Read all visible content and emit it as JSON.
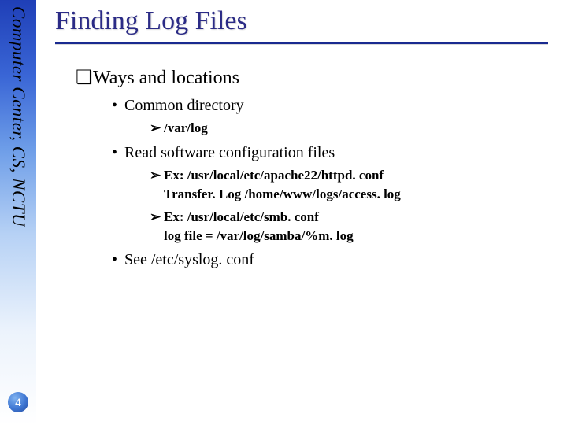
{
  "sidebar": {
    "org_text": "Computer Center, CS, NCTU"
  },
  "page_number": "4",
  "title": "Finding Log Files",
  "body": {
    "l1": {
      "marker": "❑",
      "text": "Ways and locations"
    },
    "b1": {
      "marker": "•",
      "text": "Common directory"
    },
    "b1a": {
      "marker": "➢",
      "text": "/var/log"
    },
    "b2": {
      "marker": "•",
      "text": "Read software configuration files"
    },
    "b2a": {
      "marker": "➢",
      "text": "Ex: /usr/local/etc/apache22/httpd. conf"
    },
    "b2a_cont": "Transfer. Log /home/www/logs/access. log",
    "b2b": {
      "marker": "➢",
      "text": "Ex: /usr/local/etc/smb. conf"
    },
    "b2b_cont": "log file = /var/log/samba/%m. log",
    "b3": {
      "marker": "•",
      "text": "See /etc/syslog. conf"
    }
  }
}
